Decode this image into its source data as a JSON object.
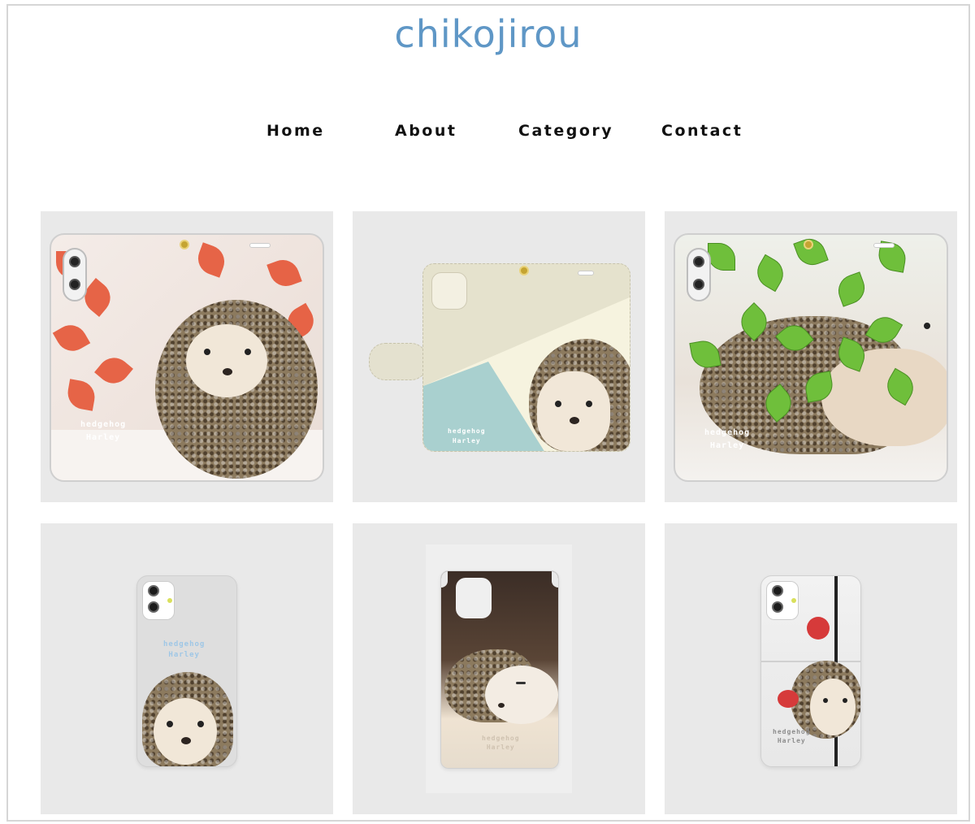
{
  "site": {
    "title": "chikojirou"
  },
  "nav": {
    "items": [
      "Home",
      "About",
      "Category",
      "Contact"
    ]
  },
  "products": [
    {
      "kind": "flip-case-autumn-leaves",
      "label_line1": "hedgehog",
      "label_line2": "Harley"
    },
    {
      "kind": "flip-case-pastel",
      "label_line1": "hedgehog",
      "label_line2": "Harley"
    },
    {
      "kind": "flip-case-green-leaves",
      "label_line1": "hedgehog",
      "label_line2": "Harley"
    },
    {
      "kind": "hard-case-grey",
      "label_line1": "hedgehog",
      "label_line2": "Harley"
    },
    {
      "kind": "cutout-case-sleeping",
      "label_line1": "hedgehog",
      "label_line2": "Harley"
    },
    {
      "kind": "hard-case-apple",
      "label_line1": "hedgehog",
      "label_line2": "Harley"
    }
  ],
  "colors": {
    "title": "#5f97c6",
    "tile_bg": "#e9e9e9",
    "nav_text": "#111111"
  }
}
